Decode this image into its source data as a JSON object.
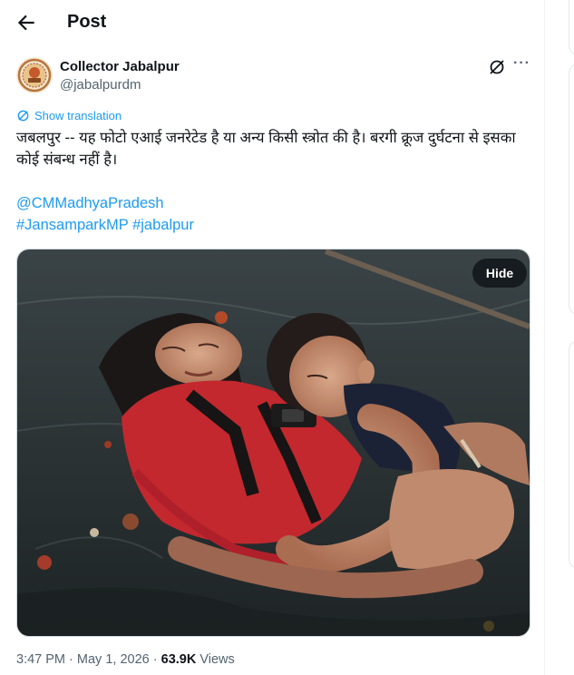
{
  "header": {
    "title": "Post"
  },
  "author": {
    "name": "Collector Jabalpur",
    "handle": "@jabalpurdm"
  },
  "post": {
    "show_translation": "Show translation",
    "text": "जबलपुर -- यह फोटो एआई जनरेटेड है या अन्य किसी स्त्रोत की है। बरगी क्रूज दुर्घटना से इसका कोई संबन्ध नहीं है।",
    "mention": "@CMMadhyaPradesh",
    "hashtags": "#JansamparkMP #jabalpur",
    "media_hide_label": "Hide"
  },
  "meta": {
    "time": "3:47 PM",
    "date": "May 1, 2026",
    "separator": "·",
    "views_count": "63.9K",
    "views_label": "Views"
  },
  "colors": {
    "link": "#1d9bf0",
    "secondary_text": "#536471"
  },
  "icons": [
    "back-arrow-icon",
    "grok-icon",
    "more-icon",
    "translate-icon"
  ]
}
